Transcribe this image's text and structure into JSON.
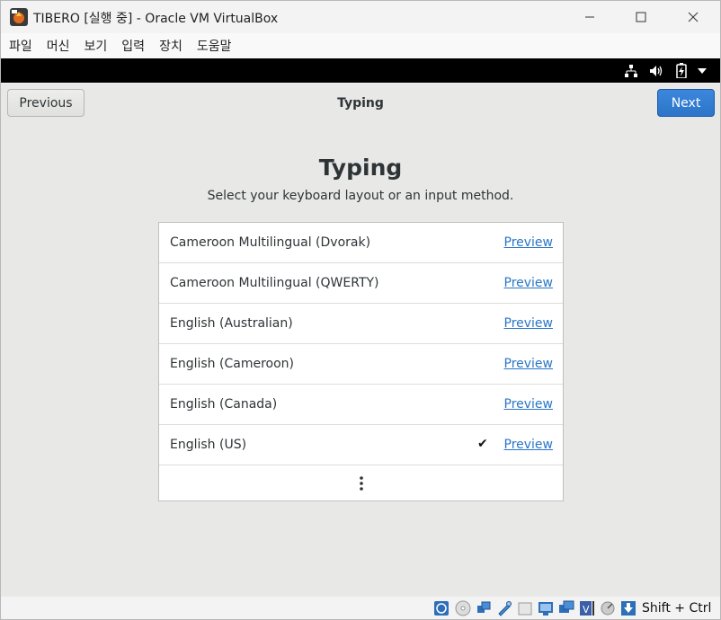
{
  "window": {
    "title": "TIBERO [실행 중] - Oracle VM VirtualBox"
  },
  "menubar": {
    "items": [
      "파일",
      "머신",
      "보기",
      "입력",
      "장치",
      "도움말"
    ]
  },
  "guest_topbar": {
    "icons": [
      "network-icon",
      "volume-icon",
      "battery-icon",
      "system-menu-arrow-icon"
    ]
  },
  "header": {
    "previous_label": "Previous",
    "title": "Typing",
    "next_label": "Next"
  },
  "page": {
    "heading": "Typing",
    "subtitle": "Select your keyboard layout or an input method."
  },
  "layouts": [
    {
      "label": "Cameroon Multilingual (Dvorak)",
      "preview": "Preview",
      "selected": false
    },
    {
      "label": "Cameroon Multilingual (QWERTY)",
      "preview": "Preview",
      "selected": false
    },
    {
      "label": "English (Australian)",
      "preview": "Preview",
      "selected": false
    },
    {
      "label": "English (Cameroon)",
      "preview": "Preview",
      "selected": false
    },
    {
      "label": "English (Canada)",
      "preview": "Preview",
      "selected": false
    },
    {
      "label": "English (US)",
      "preview": "Preview",
      "selected": true
    }
  ],
  "statusbar": {
    "host_key": "Shift + Ctrl"
  },
  "colors": {
    "accent": "#2c75c9",
    "link": "#2a76c6",
    "guest_bg": "#e8e8e7"
  }
}
